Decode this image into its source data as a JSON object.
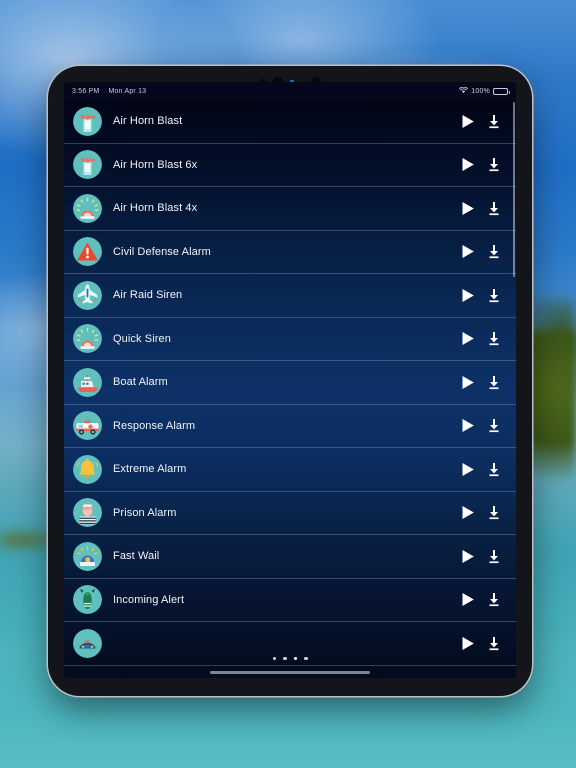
{
  "statusbar": {
    "time": "3:56 PM",
    "date": "Mon Apr 13",
    "battery_percent": "100%",
    "wifi_icon": "wifi-icon",
    "battery_icon": "battery-icon"
  },
  "list": {
    "play_icon": "play-icon",
    "download_icon": "download-icon",
    "rows": [
      {
        "label": "Air Horn Blast",
        "icon": "air-horn-can-icon",
        "bg": "#5fc0bd"
      },
      {
        "label": "Air Horn Blast 6x",
        "icon": "air-horn-can-icon",
        "bg": "#5fc0bd"
      },
      {
        "label": "Air Horn Blast 4x",
        "icon": "siren-light-icon",
        "bg": "#5fc0bd"
      },
      {
        "label": "Civil Defense Alarm",
        "icon": "warning-triangle-icon",
        "bg": "#5fc0bd"
      },
      {
        "label": "Air Raid Siren",
        "icon": "airplane-icon",
        "bg": "#5fc0bd"
      },
      {
        "label": "Quick Siren",
        "icon": "siren-light-icon",
        "bg": "#5fc0bd"
      },
      {
        "label": "Boat Alarm",
        "icon": "boat-icon",
        "bg": "#5fc0bd"
      },
      {
        "label": "Response Alarm",
        "icon": "ambulance-icon",
        "bg": "#5fc0bd"
      },
      {
        "label": "Extreme Alarm",
        "icon": "bell-icon",
        "bg": "#5fc0bd"
      },
      {
        "label": "Prison Alarm",
        "icon": "prisoner-icon",
        "bg": "#5fc0bd"
      },
      {
        "label": "Fast Wail",
        "icon": "siren-dome-icon",
        "bg": "#5fc0bd"
      },
      {
        "label": "Incoming Alert",
        "icon": "bomb-icon",
        "bg": "#5fc0bd"
      },
      {
        "label": "",
        "icon": "police-car-icon",
        "bg": "#5fc0bd"
      }
    ]
  },
  "page_dots": {
    "count": 4,
    "active_index": 2
  },
  "colors": {
    "accent_icon_bg": "#5fc0bd",
    "list_top": "#020515",
    "list_mid": "#0d3168",
    "text": "#f2f4f8"
  }
}
